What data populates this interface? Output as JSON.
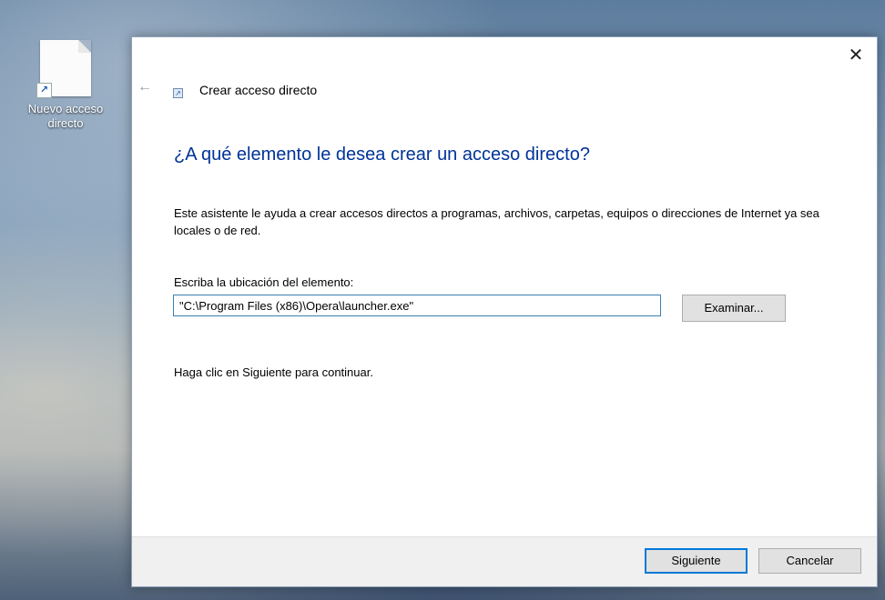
{
  "desktop": {
    "icon_label": "Nuevo acceso directo"
  },
  "window": {
    "title": "Crear acceso directo",
    "close_glyph": "✕",
    "back_glyph": "←",
    "heading": "¿A qué elemento le desea crear un acceso directo?",
    "description": "Este asistente le ayuda a crear accesos directos a programas, archivos, carpetas, equipos o direcciones de Internet ya sea locales o de red.",
    "location_label": "Escriba la ubicación del elemento:",
    "location_value": "\"C:\\Program Files (x86)\\Opera\\launcher.exe\"",
    "browse_label": "Examinar...",
    "continue_text": "Haga clic en Siguiente para continuar.",
    "next_label": "Siguiente",
    "cancel_label": "Cancelar"
  },
  "colors": {
    "heading": "#003399",
    "accent": "#0078d7"
  },
  "icons": [
    "shortcut-file-icon",
    "back-arrow-icon",
    "close-icon",
    "shortcut-wizard-icon"
  ]
}
